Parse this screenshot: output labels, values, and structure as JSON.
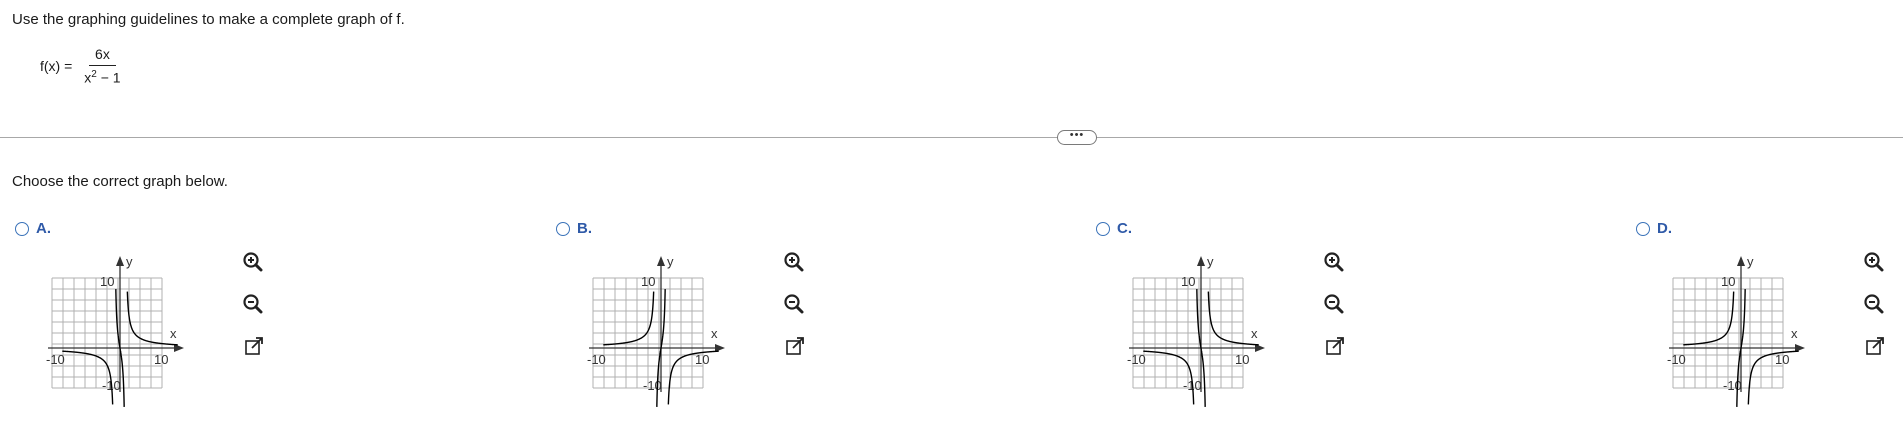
{
  "question": {
    "instruction": "Use the graphing guidelines to make a complete graph of f.",
    "function_lhs": "f(x) =",
    "numerator": "6x",
    "denominator_base": "x",
    "denominator_exponent": "2",
    "denominator_rest": " − 1"
  },
  "more_button": "•••",
  "prompt": "Choose the correct graph below.",
  "options": [
    {
      "letter": "A.",
      "variant": "A"
    },
    {
      "letter": "B.",
      "variant": "B"
    },
    {
      "letter": "C.",
      "variant": "C"
    },
    {
      "letter": "D.",
      "variant": "D"
    }
  ],
  "graph_labels": {
    "x_axis": "x",
    "y_axis": "y",
    "x_min": "-10",
    "x_max": "10",
    "y_max": "10",
    "y_min": "-10"
  },
  "tools": {
    "zoom_in": "zoom-in-icon",
    "zoom_out": "zoom-out-icon",
    "popout": "external-link-icon"
  },
  "colors": {
    "accent": "#2f5aa8",
    "radio": "#3b73b9",
    "grid": "#b0b0b0",
    "curve": "#000000"
  }
}
